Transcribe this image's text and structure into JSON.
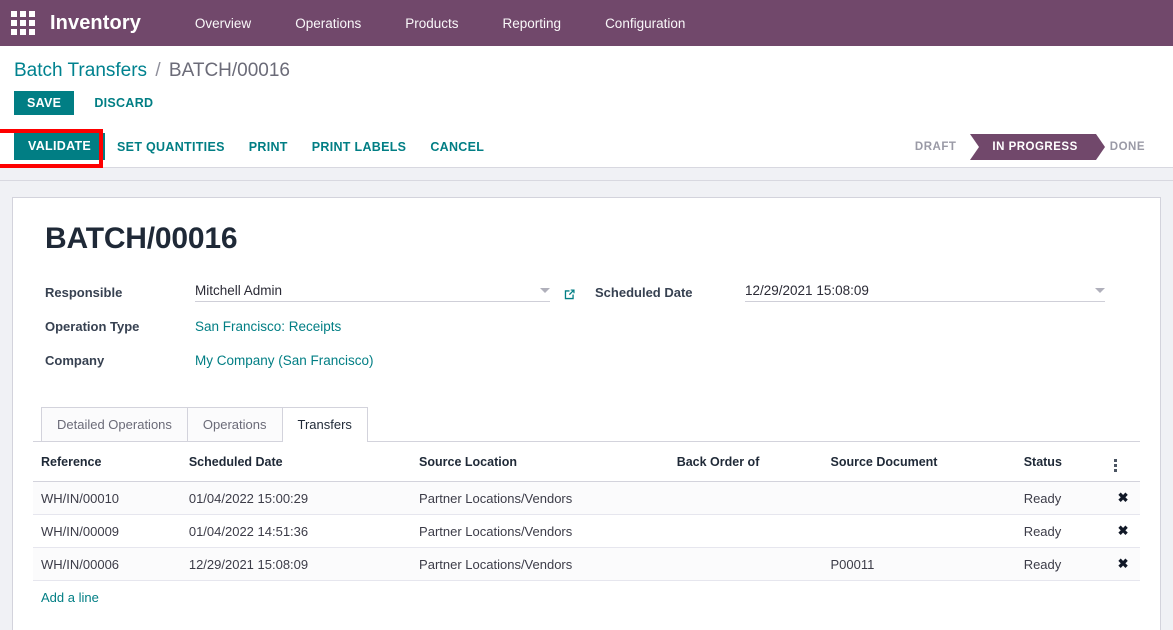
{
  "navbar": {
    "apps_icon": "apps-grid-icon",
    "brand": "Inventory",
    "menu": [
      {
        "label": "Overview"
      },
      {
        "label": "Operations"
      },
      {
        "label": "Products"
      },
      {
        "label": "Reporting"
      },
      {
        "label": "Configuration"
      }
    ]
  },
  "breadcrumb": {
    "root": "Batch Transfers",
    "separator": "/",
    "current": "BATCH/00016"
  },
  "savebar": {
    "save_label": "SAVE",
    "discard_label": "DISCARD"
  },
  "actions": {
    "validate_label": "VALIDATE",
    "set_quantities_label": "SET QUANTITIES",
    "print_label": "PRINT",
    "print_labels_label": "PRINT LABELS",
    "cancel_label": "CANCEL"
  },
  "status_pipeline": {
    "stages": [
      {
        "label": "DRAFT",
        "active": false
      },
      {
        "label": "IN PROGRESS",
        "active": true
      },
      {
        "label": "DONE",
        "active": false
      }
    ],
    "active_color": "#71486b"
  },
  "record": {
    "title": "BATCH/00016",
    "fields": {
      "responsible_label": "Responsible",
      "responsible_value": "Mitchell Admin",
      "operation_type_label": "Operation Type",
      "operation_type_value": "San Francisco: Receipts",
      "company_label": "Company",
      "company_value": "My Company (San Francisco)",
      "scheduled_date_label": "Scheduled Date",
      "scheduled_date_value": "12/29/2021 15:08:09"
    }
  },
  "notebook": {
    "tabs": [
      {
        "label": "Detailed Operations",
        "active": false
      },
      {
        "label": "Operations",
        "active": false
      },
      {
        "label": "Transfers",
        "active": true
      }
    ],
    "table": {
      "columns": [
        "Reference",
        "Scheduled Date",
        "Source Location",
        "Back Order of",
        "Source Document",
        "Status"
      ],
      "rows": [
        {
          "reference": "WH/IN/00010",
          "scheduled_date": "01/04/2022 15:00:29",
          "source_location": "Partner Locations/Vendors",
          "back_order_of": "",
          "source_document": "",
          "status": "Ready",
          "delete_icon": "✖"
        },
        {
          "reference": "WH/IN/00009",
          "scheduled_date": "01/04/2022 14:51:36",
          "source_location": "Partner Locations/Vendors",
          "back_order_of": "",
          "source_document": "",
          "status": "Ready",
          "delete_icon": "✖"
        },
        {
          "reference": "WH/IN/00006",
          "scheduled_date": "12/29/2021 15:08:09",
          "source_location": "Partner Locations/Vendors",
          "back_order_of": "",
          "source_document": "P00011",
          "status": "Ready",
          "delete_icon": "✖"
        }
      ],
      "add_line_label": "Add a line"
    }
  },
  "theme": {
    "brand_purple": "#71486b",
    "accent_teal": "#017e84",
    "annotation_red": "#fe0000",
    "page_bg": "#f0f1f5"
  }
}
